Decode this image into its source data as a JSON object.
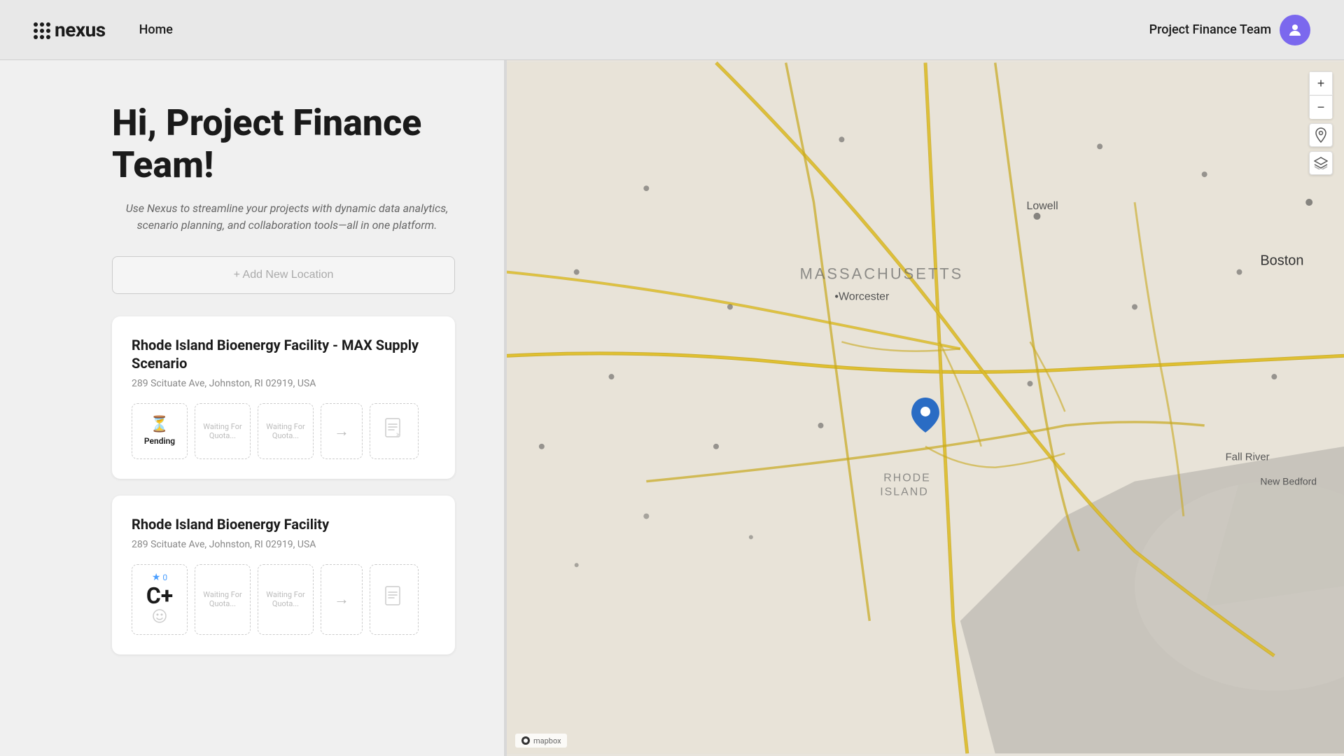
{
  "header": {
    "logo_text": "nexus",
    "nav_home": "Home",
    "user_name": "Project Finance Team",
    "user_avatar_icon": "person-icon"
  },
  "hero": {
    "greeting": "Hi, Project Finance Team!",
    "subtitle": "Use Nexus to streamline your projects with dynamic data analytics, scenario planning, and collaboration tools—all in one platform.",
    "add_location_label": "+ Add New Location"
  },
  "locations": [
    {
      "title": "Rhode Island Bioenergy Facility - MAX Supply Scenario",
      "address": "289 Scituate Ave, Johnston, RI 02919, USA",
      "status_cards": [
        {
          "type": "pending",
          "icon": "⏳",
          "label": "Pending"
        },
        {
          "type": "waiting",
          "text": "Waiting For Quota..."
        },
        {
          "type": "waiting",
          "text": "Waiting For Quota..."
        },
        {
          "type": "arrow"
        },
        {
          "type": "doc"
        }
      ]
    },
    {
      "title": "Rhode Island Bioenergy Facility",
      "address": "289 Scituate Ave, Johnston, RI 02919, USA",
      "status_cards": [
        {
          "type": "grade",
          "grade": "C+",
          "stars": 0
        },
        {
          "type": "waiting",
          "text": "Waiting For Quota..."
        },
        {
          "type": "waiting",
          "text": "Waiting For Quota..."
        },
        {
          "type": "arrow"
        },
        {
          "type": "doc"
        }
      ]
    }
  ],
  "map": {
    "zoom_in": "+",
    "zoom_out": "−",
    "location_pin_icon": "📍",
    "layers_icon": "layers-icon",
    "attribution": "© Mapbox",
    "mapbox_logo": "mapbox"
  }
}
